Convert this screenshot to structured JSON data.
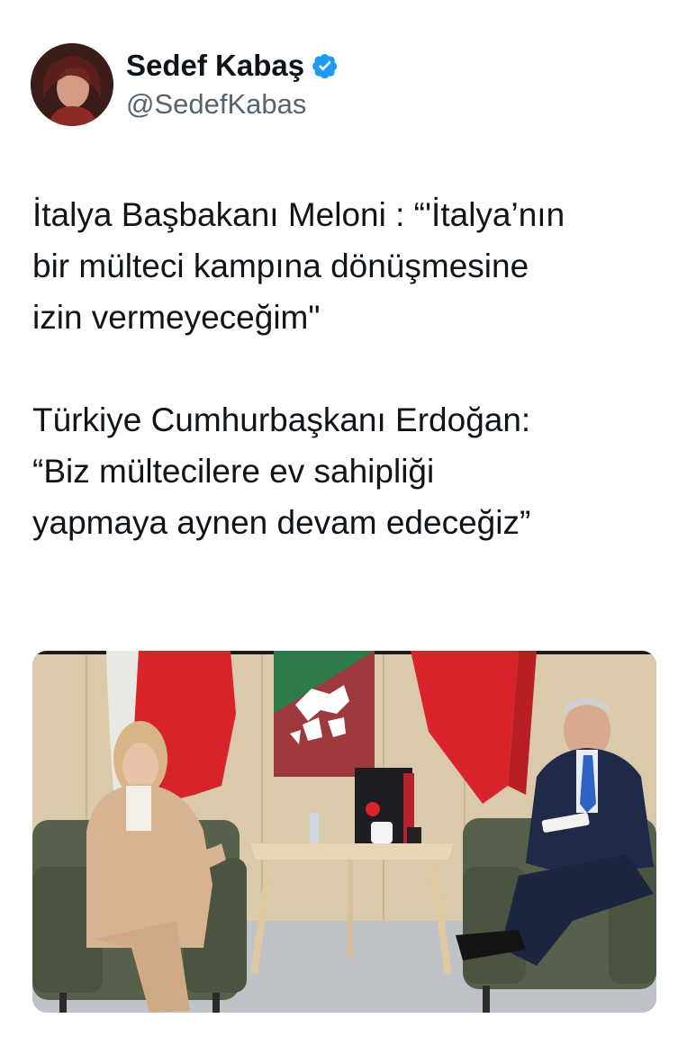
{
  "author": {
    "display_name": "Sedef Kabaş",
    "handle": "@SedefKabas",
    "verified": true,
    "avatar_icon": "avatar-photo"
  },
  "tweet": {
    "paragraphs": [
      [
        "İtalya Başbakanı Meloni : “'İtalya’nın",
        "bir mülteci kampına dönüşmesine",
        "izin vermeyeceğim\""
      ],
      [
        "Türkiye Cumhurbaşkanı Erdoğan:",
        "“Biz mültecilere ev sahipliği",
        "yapmaya aynen devam edeceğiz”"
      ]
    ]
  },
  "media": {
    "type": "photo",
    "description_icon": "meeting-photo"
  },
  "colors": {
    "text": "#0f1419",
    "secondary": "#536471",
    "verified": "#1d9bf0"
  }
}
